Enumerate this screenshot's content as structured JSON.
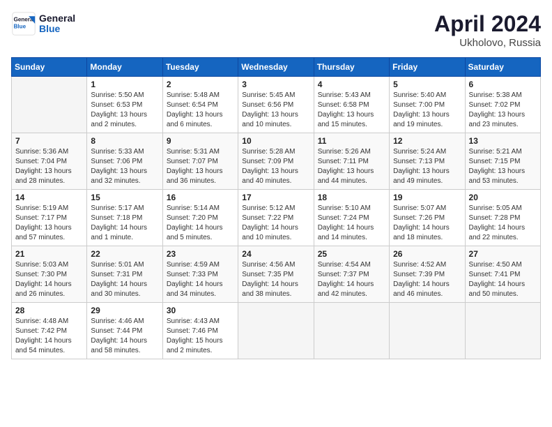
{
  "header": {
    "logo_line1": "General",
    "logo_line2": "Blue",
    "month": "April 2024",
    "location": "Ukholovo, Russia"
  },
  "weekdays": [
    "Sunday",
    "Monday",
    "Tuesday",
    "Wednesday",
    "Thursday",
    "Friday",
    "Saturday"
  ],
  "weeks": [
    [
      {
        "day": "",
        "info": ""
      },
      {
        "day": "1",
        "info": "Sunrise: 5:50 AM\nSunset: 6:53 PM\nDaylight: 13 hours\nand 2 minutes."
      },
      {
        "day": "2",
        "info": "Sunrise: 5:48 AM\nSunset: 6:54 PM\nDaylight: 13 hours\nand 6 minutes."
      },
      {
        "day": "3",
        "info": "Sunrise: 5:45 AM\nSunset: 6:56 PM\nDaylight: 13 hours\nand 10 minutes."
      },
      {
        "day": "4",
        "info": "Sunrise: 5:43 AM\nSunset: 6:58 PM\nDaylight: 13 hours\nand 15 minutes."
      },
      {
        "day": "5",
        "info": "Sunrise: 5:40 AM\nSunset: 7:00 PM\nDaylight: 13 hours\nand 19 minutes."
      },
      {
        "day": "6",
        "info": "Sunrise: 5:38 AM\nSunset: 7:02 PM\nDaylight: 13 hours\nand 23 minutes."
      }
    ],
    [
      {
        "day": "7",
        "info": "Sunrise: 5:36 AM\nSunset: 7:04 PM\nDaylight: 13 hours\nand 28 minutes."
      },
      {
        "day": "8",
        "info": "Sunrise: 5:33 AM\nSunset: 7:06 PM\nDaylight: 13 hours\nand 32 minutes."
      },
      {
        "day": "9",
        "info": "Sunrise: 5:31 AM\nSunset: 7:07 PM\nDaylight: 13 hours\nand 36 minutes."
      },
      {
        "day": "10",
        "info": "Sunrise: 5:28 AM\nSunset: 7:09 PM\nDaylight: 13 hours\nand 40 minutes."
      },
      {
        "day": "11",
        "info": "Sunrise: 5:26 AM\nSunset: 7:11 PM\nDaylight: 13 hours\nand 44 minutes."
      },
      {
        "day": "12",
        "info": "Sunrise: 5:24 AM\nSunset: 7:13 PM\nDaylight: 13 hours\nand 49 minutes."
      },
      {
        "day": "13",
        "info": "Sunrise: 5:21 AM\nSunset: 7:15 PM\nDaylight: 13 hours\nand 53 minutes."
      }
    ],
    [
      {
        "day": "14",
        "info": "Sunrise: 5:19 AM\nSunset: 7:17 PM\nDaylight: 13 hours\nand 57 minutes."
      },
      {
        "day": "15",
        "info": "Sunrise: 5:17 AM\nSunset: 7:18 PM\nDaylight: 14 hours\nand 1 minute."
      },
      {
        "day": "16",
        "info": "Sunrise: 5:14 AM\nSunset: 7:20 PM\nDaylight: 14 hours\nand 5 minutes."
      },
      {
        "day": "17",
        "info": "Sunrise: 5:12 AM\nSunset: 7:22 PM\nDaylight: 14 hours\nand 10 minutes."
      },
      {
        "day": "18",
        "info": "Sunrise: 5:10 AM\nSunset: 7:24 PM\nDaylight: 14 hours\nand 14 minutes."
      },
      {
        "day": "19",
        "info": "Sunrise: 5:07 AM\nSunset: 7:26 PM\nDaylight: 14 hours\nand 18 minutes."
      },
      {
        "day": "20",
        "info": "Sunrise: 5:05 AM\nSunset: 7:28 PM\nDaylight: 14 hours\nand 22 minutes."
      }
    ],
    [
      {
        "day": "21",
        "info": "Sunrise: 5:03 AM\nSunset: 7:30 PM\nDaylight: 14 hours\nand 26 minutes."
      },
      {
        "day": "22",
        "info": "Sunrise: 5:01 AM\nSunset: 7:31 PM\nDaylight: 14 hours\nand 30 minutes."
      },
      {
        "day": "23",
        "info": "Sunrise: 4:59 AM\nSunset: 7:33 PM\nDaylight: 14 hours\nand 34 minutes."
      },
      {
        "day": "24",
        "info": "Sunrise: 4:56 AM\nSunset: 7:35 PM\nDaylight: 14 hours\nand 38 minutes."
      },
      {
        "day": "25",
        "info": "Sunrise: 4:54 AM\nSunset: 7:37 PM\nDaylight: 14 hours\nand 42 minutes."
      },
      {
        "day": "26",
        "info": "Sunrise: 4:52 AM\nSunset: 7:39 PM\nDaylight: 14 hours\nand 46 minutes."
      },
      {
        "day": "27",
        "info": "Sunrise: 4:50 AM\nSunset: 7:41 PM\nDaylight: 14 hours\nand 50 minutes."
      }
    ],
    [
      {
        "day": "28",
        "info": "Sunrise: 4:48 AM\nSunset: 7:42 PM\nDaylight: 14 hours\nand 54 minutes."
      },
      {
        "day": "29",
        "info": "Sunrise: 4:46 AM\nSunset: 7:44 PM\nDaylight: 14 hours\nand 58 minutes."
      },
      {
        "day": "30",
        "info": "Sunrise: 4:43 AM\nSunset: 7:46 PM\nDaylight: 15 hours\nand 2 minutes."
      },
      {
        "day": "",
        "info": ""
      },
      {
        "day": "",
        "info": ""
      },
      {
        "day": "",
        "info": ""
      },
      {
        "day": "",
        "info": ""
      }
    ]
  ]
}
